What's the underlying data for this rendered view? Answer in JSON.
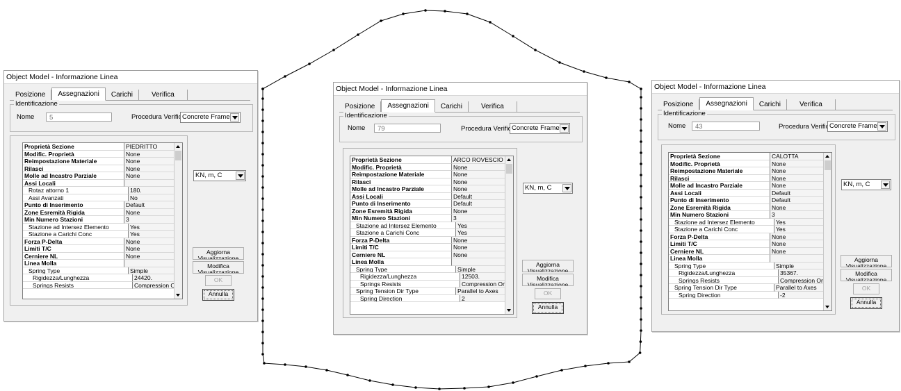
{
  "dialogs": [
    {
      "title": "Object Model - Informazione Linea",
      "tabs": [
        "Posizione",
        "Assegnazioni",
        "Carichi",
        "Verifica"
      ],
      "active_tab": "Assegnazioni",
      "ident_group": "Identificazione",
      "nome_label": "Nome",
      "nome_value": "5",
      "proc_label": "Procedura Verifiche",
      "proc_value": "Concrete Frame",
      "units": "KN, m, C",
      "btn_aggiorna": "Aggiorna Visualizzazione",
      "btn_modifica": "Modifica Visualizzazione",
      "btn_ok": "OK",
      "btn_annulla": "Annulla",
      "rows": [
        {
          "k": "Proprietà Sezione",
          "v": "PIEDRITTO",
          "bold": true,
          "indent": 0
        },
        {
          "k": "Modific. Proprietà",
          "v": "None",
          "bold": true,
          "indent": 0
        },
        {
          "k": "Reimpostazione Materiale",
          "v": "None",
          "bold": true,
          "indent": 0
        },
        {
          "k": "Rilasci",
          "v": "None",
          "bold": true,
          "indent": 0
        },
        {
          "k": "Molle ad Incastro Parziale",
          "v": "None",
          "bold": true,
          "indent": 0
        },
        {
          "k": "Assi Locali",
          "v": "",
          "bold": true,
          "indent": 0
        },
        {
          "k": "Rotaz attorno 1",
          "v": "180.",
          "bold": false,
          "indent": 1
        },
        {
          "k": "Assi Avanzati",
          "v": "No",
          "bold": false,
          "indent": 1
        },
        {
          "k": "Punto di Inserimento",
          "v": "Default",
          "bold": true,
          "indent": 0
        },
        {
          "k": "Zone Esremità Rigida",
          "v": "None",
          "bold": true,
          "indent": 0
        },
        {
          "k": "Min Numero Stazioni",
          "v": "3",
          "bold": true,
          "indent": 0
        },
        {
          "k": "Stazione ad Intersez Elemento",
          "v": "Yes",
          "bold": false,
          "indent": 1
        },
        {
          "k": "Stazione a Carichi Conc",
          "v": "Yes",
          "bold": false,
          "indent": 1
        },
        {
          "k": "Forza P-Delta",
          "v": "None",
          "bold": true,
          "indent": 0
        },
        {
          "k": "Limiti T/C",
          "v": "None",
          "bold": true,
          "indent": 0
        },
        {
          "k": "Cerniere NL",
          "v": "None",
          "bold": true,
          "indent": 0
        },
        {
          "k": "Linea Molla",
          "v": "",
          "bold": true,
          "indent": 0
        },
        {
          "k": "Spring Type",
          "v": "Simple",
          "bold": false,
          "indent": 1
        },
        {
          "k": "Rigidezza/Lunghezza",
          "v": "24420.",
          "bold": false,
          "indent": 2
        },
        {
          "k": "Springs Resists",
          "v": "Compression Only",
          "bold": false,
          "indent": 2
        }
      ]
    },
    {
      "title": "Object Model - Informazione Linea",
      "tabs": [
        "Posizione",
        "Assegnazioni",
        "Carichi",
        "Verifica"
      ],
      "active_tab": "Assegnazioni",
      "ident_group": "Identificazione",
      "nome_label": "Nome",
      "nome_value": "79",
      "proc_label": "Procedura Verifiche",
      "proc_value": "Concrete Frame",
      "units": "KN, m, C",
      "btn_aggiorna": "Aggiorna Visualizzazione",
      "btn_modifica": "Modifica Visualizzazione",
      "btn_ok": "OK",
      "btn_annulla": "Annulla",
      "rows": [
        {
          "k": "Proprietà Sezione",
          "v": "ARCO ROVESCIO",
          "bold": true,
          "indent": 0
        },
        {
          "k": "Modific. Proprietà",
          "v": "None",
          "bold": true,
          "indent": 0
        },
        {
          "k": "Reimpostazione Materiale",
          "v": "None",
          "bold": true,
          "indent": 0
        },
        {
          "k": "Rilasci",
          "v": "None",
          "bold": true,
          "indent": 0
        },
        {
          "k": "Molle ad Incastro Parziale",
          "v": "None",
          "bold": true,
          "indent": 0
        },
        {
          "k": "Assi Locali",
          "v": "Default",
          "bold": true,
          "indent": 0
        },
        {
          "k": "Punto di Inserimento",
          "v": "Default",
          "bold": true,
          "indent": 0
        },
        {
          "k": "Zone Esremità Rigida",
          "v": "None",
          "bold": true,
          "indent": 0
        },
        {
          "k": "Min Numero Stazioni",
          "v": "3",
          "bold": true,
          "indent": 0
        },
        {
          "k": "Stazione ad Intersez Elemento",
          "v": "Yes",
          "bold": false,
          "indent": 1
        },
        {
          "k": "Stazione a Carichi Conc",
          "v": "Yes",
          "bold": false,
          "indent": 1
        },
        {
          "k": "Forza P-Delta",
          "v": "None",
          "bold": true,
          "indent": 0
        },
        {
          "k": "Limiti T/C",
          "v": "None",
          "bold": true,
          "indent": 0
        },
        {
          "k": "Cerniere NL",
          "v": "None",
          "bold": true,
          "indent": 0
        },
        {
          "k": "Linea Molla",
          "v": "",
          "bold": true,
          "indent": 0
        },
        {
          "k": "Spring Type",
          "v": "Simple",
          "bold": false,
          "indent": 1
        },
        {
          "k": "Rigidezza/Lunghezza",
          "v": "12503.",
          "bold": false,
          "indent": 2
        },
        {
          "k": "Springs Resists",
          "v": "Compression Only",
          "bold": false,
          "indent": 2
        },
        {
          "k": "Spring Tension Dir Type",
          "v": "Parallel to Axes",
          "bold": false,
          "indent": 1
        },
        {
          "k": "Spring Direction",
          "v": "2",
          "bold": false,
          "indent": 2
        }
      ]
    },
    {
      "title": "Object Model - Informazione Linea",
      "tabs": [
        "Posizione",
        "Assegnazioni",
        "Carichi",
        "Verifica"
      ],
      "active_tab": "Assegnazioni",
      "ident_group": "Identificazione",
      "nome_label": "Nome",
      "nome_value": "43",
      "proc_label": "Procedura Verifiche",
      "proc_value": "Concrete Frame",
      "units": "KN, m, C",
      "btn_aggiorna": "Aggiorna Visualizzazione",
      "btn_modifica": "Modifica Visualizzazione",
      "btn_ok": "OK",
      "btn_annulla": "Annulla",
      "rows": [
        {
          "k": "Proprietà Sezione",
          "v": "CALOTTA",
          "bold": true,
          "indent": 0
        },
        {
          "k": "Modific. Proprietà",
          "v": "None",
          "bold": true,
          "indent": 0
        },
        {
          "k": "Reimpostazione Materiale",
          "v": "None",
          "bold": true,
          "indent": 0
        },
        {
          "k": "Rilasci",
          "v": "None",
          "bold": true,
          "indent": 0
        },
        {
          "k": "Molle ad Incastro Parziale",
          "v": "None",
          "bold": true,
          "indent": 0
        },
        {
          "k": "Assi Locali",
          "v": "Default",
          "bold": true,
          "indent": 0
        },
        {
          "k": "Punto di Inserimento",
          "v": "Default",
          "bold": true,
          "indent": 0
        },
        {
          "k": "Zone Esremità Rigida",
          "v": "None",
          "bold": true,
          "indent": 0
        },
        {
          "k": "Min Numero Stazioni",
          "v": "3",
          "bold": true,
          "indent": 0
        },
        {
          "k": "Stazione ad Intersez Elemento",
          "v": "Yes",
          "bold": false,
          "indent": 1
        },
        {
          "k": "Stazione a Carichi Conc",
          "v": "Yes",
          "bold": false,
          "indent": 1
        },
        {
          "k": "Forza P-Delta",
          "v": "None",
          "bold": true,
          "indent": 0
        },
        {
          "k": "Limiti T/C",
          "v": "None",
          "bold": true,
          "indent": 0
        },
        {
          "k": "Cerniere NL",
          "v": "None",
          "bold": true,
          "indent": 0
        },
        {
          "k": "Linea Molla",
          "v": "",
          "bold": true,
          "indent": 0
        },
        {
          "k": "Spring Type",
          "v": "Simple",
          "bold": false,
          "indent": 1
        },
        {
          "k": "Rigidezza/Lunghezza",
          "v": "35367.",
          "bold": false,
          "indent": 2
        },
        {
          "k": "Springs Resists",
          "v": "Compression Only",
          "bold": false,
          "indent": 2
        },
        {
          "k": "Spring Tension Dir Type",
          "v": "Parallel to Axes",
          "bold": false,
          "indent": 1
        },
        {
          "k": "Spring Direction",
          "v": "-2",
          "bold": false,
          "indent": 2
        }
      ]
    }
  ]
}
